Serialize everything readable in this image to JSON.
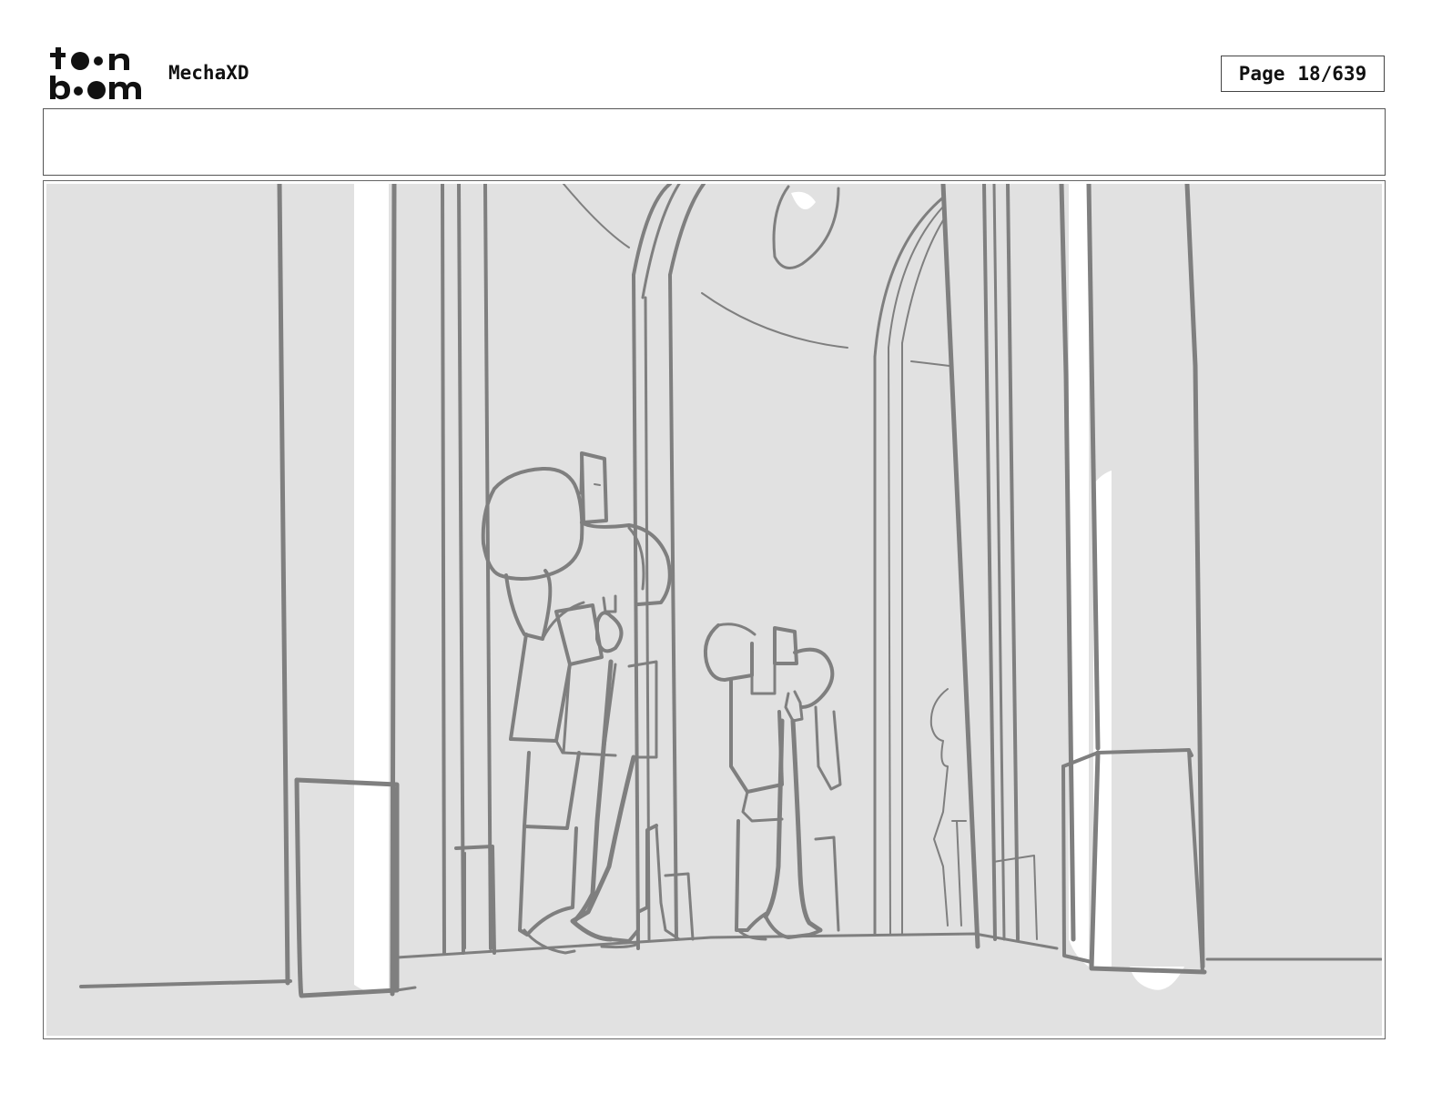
{
  "header": {
    "logo_alt": "toon boom",
    "project_title": "MechaXD",
    "page_label": "Page",
    "page_number": "18/639"
  },
  "caption": {
    "text": ""
  },
  "colors": {
    "panel_bg": "#e1e1e1",
    "line": "#7f7f7f",
    "highlight": "#ffffff"
  }
}
